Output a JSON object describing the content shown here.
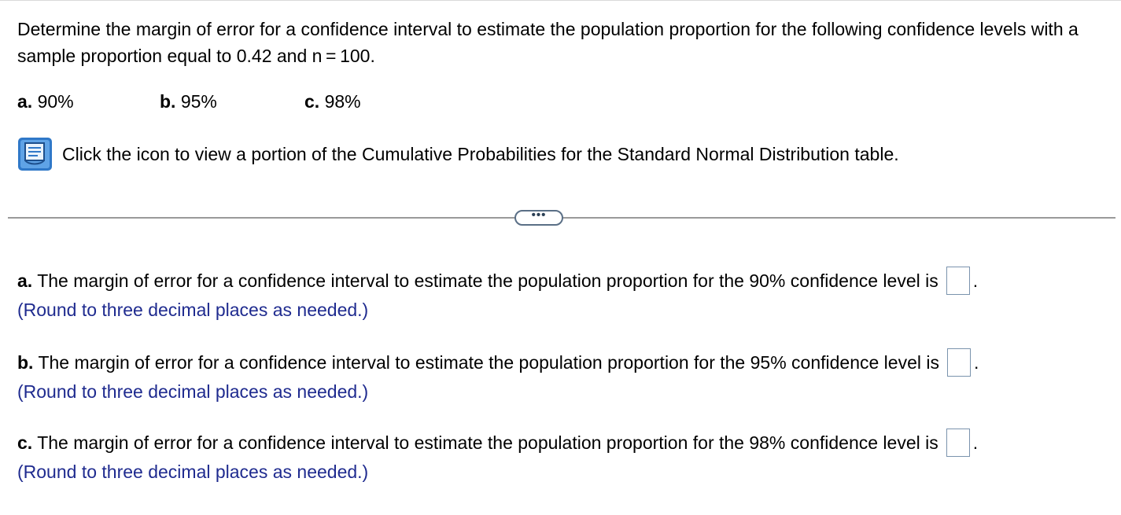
{
  "question": {
    "text": "Determine the margin of error for a confidence interval to estimate the population proportion for the following confidence levels with a sample proportion equal to 0.42 and n = 100."
  },
  "parts": [
    {
      "label": "a.",
      "value": "90%"
    },
    {
      "label": "b.",
      "value": "95%"
    },
    {
      "label": "c.",
      "value": "98%"
    }
  ],
  "table_link": {
    "icon": "table-book-icon",
    "text": "Click the icon to view a portion of the Cumulative Probabilities for the Standard Normal Distribution table."
  },
  "more_button": {
    "label": "•••"
  },
  "answers": [
    {
      "label": "a.",
      "text": "The margin of error for a confidence interval to estimate the population proportion for the 90% confidence level is",
      "value": "",
      "period": ".",
      "hint": "(Round to three decimal places as needed.)"
    },
    {
      "label": "b.",
      "text": "The margin of error for a confidence interval to estimate the population proportion for the 95% confidence level is",
      "value": "",
      "period": ".",
      "hint": "(Round to three decimal places as needed.)"
    },
    {
      "label": "c.",
      "text": "The margin of error for a confidence interval to estimate the population proportion for the 98% confidence level is",
      "value": "",
      "period": ".",
      "hint": "(Round to three decimal places as needed.)"
    }
  ],
  "colors": {
    "hint_text": "#1f2b8f",
    "icon_blue": "#2f78c8",
    "divider": "#9a9a9a",
    "answer_box_border": "#7a93ad"
  }
}
